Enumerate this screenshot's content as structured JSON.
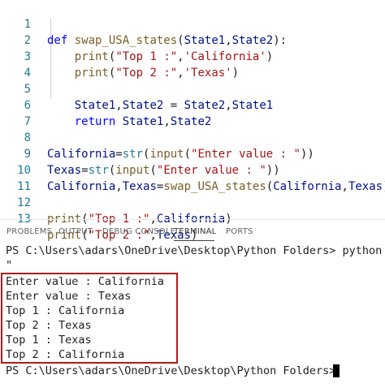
{
  "editor": {
    "lines": [
      {
        "num": "1",
        "code": "def swap_USA_states(State1,State2):"
      },
      {
        "num": "2",
        "code": "    print(\"Top 1 :\",'California')"
      },
      {
        "num": "3",
        "code": "    print(\"Top 2 :\",'Texas')"
      },
      {
        "num": "4",
        "code": ""
      },
      {
        "num": "5",
        "code": "    State1,State2 = State2,State1"
      },
      {
        "num": "6",
        "code": "    return State1,State2"
      },
      {
        "num": "7",
        "code": ""
      },
      {
        "num": "8",
        "code": "California=str(input(\"Enter value : \"))"
      },
      {
        "num": "9",
        "code": "Texas=str(input(\"Enter value : \"))"
      },
      {
        "num": "10",
        "code": "California,Texas=swap_USA_states(California,Texas)"
      },
      {
        "num": "11",
        "code": ""
      },
      {
        "num": "12",
        "code": "print(\"Top 1 :\",California)"
      },
      {
        "num": "13",
        "code": "print(\"Top 2 :\",Texas)"
      }
    ]
  },
  "panel": {
    "tabs": [
      "PROBLEMS",
      "OUTPUT",
      "DEBUG CONSOLE",
      "TERMINAL",
      "PORTS"
    ],
    "active_tab": "TERMINAL"
  },
  "terminal": {
    "prompt_line": "PS C:\\Users\\adars\\OneDrive\\Desktop\\Python Folders> python -",
    "continuation": "\"",
    "output": [
      "Enter value : California",
      "Enter value : Texas",
      "Top 1 : California",
      "Top 2 : Texas",
      "Top 1 : Texas",
      "Top 2 : California"
    ],
    "final_prompt": "PS C:\\Users\\adars\\OneDrive\\Desktop\\Python Folders>"
  },
  "colors": {
    "highlight_border": "#b01c1c",
    "line_number": "#237893",
    "keyword": "#0000ff",
    "function": "#795e26",
    "string": "#a31515"
  }
}
